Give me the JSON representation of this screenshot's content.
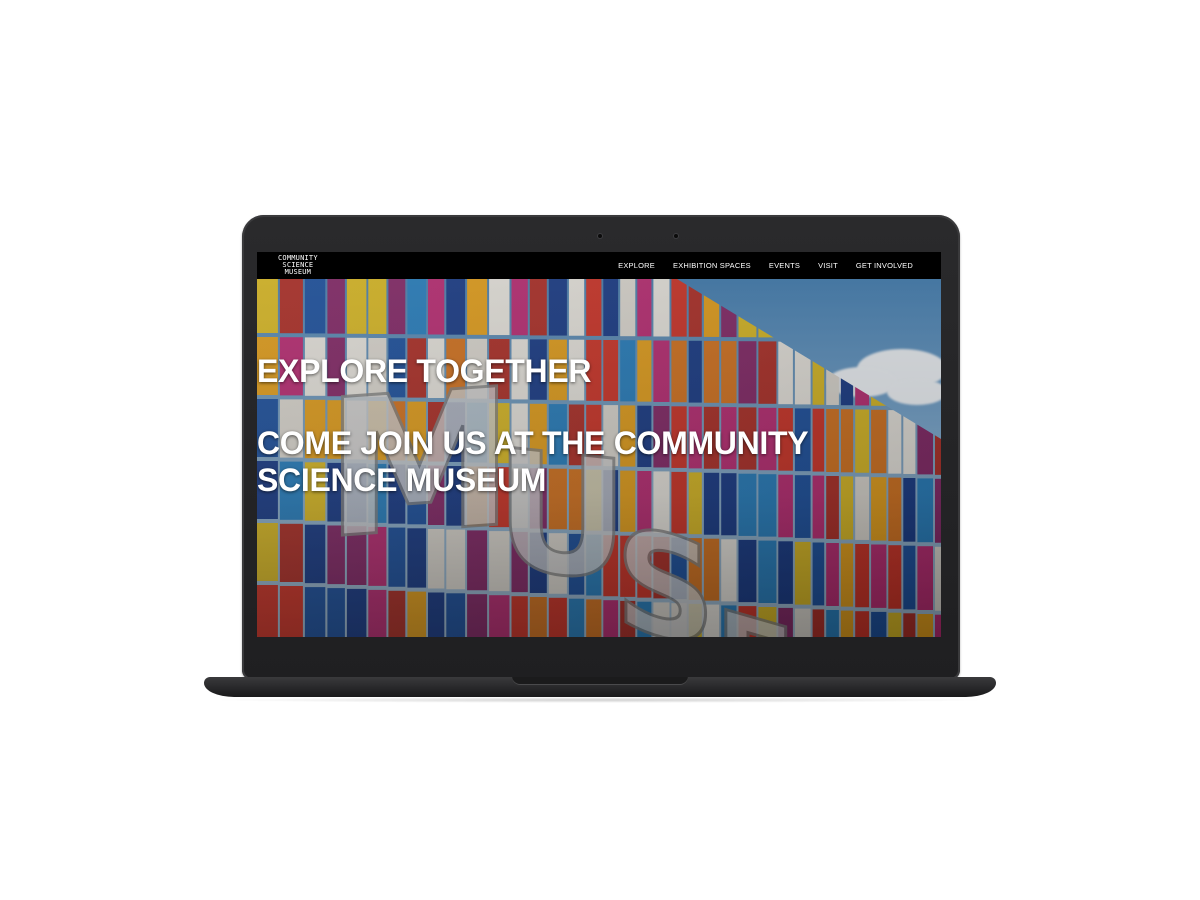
{
  "site": {
    "logo_lines": [
      "COMMUNITY",
      "SCIENCE",
      "MUSEUM"
    ]
  },
  "nav": {
    "items": [
      {
        "label": "EXPLORE"
      },
      {
        "label": "EXHIBITION SPACES"
      },
      {
        "label": "EVENTS"
      },
      {
        "label": "VISIT"
      },
      {
        "label": "GET INVOLVED"
      }
    ]
  },
  "hero": {
    "headline": "EXPLORE TOGETHER",
    "subheadline": "COME JOIN US AT THE COMMUNITY SCIENCE MUSEUM"
  },
  "colors": {
    "navbar_bg": "#000000",
    "hero_text": "#ffffff",
    "laptop_body": "#232325"
  }
}
